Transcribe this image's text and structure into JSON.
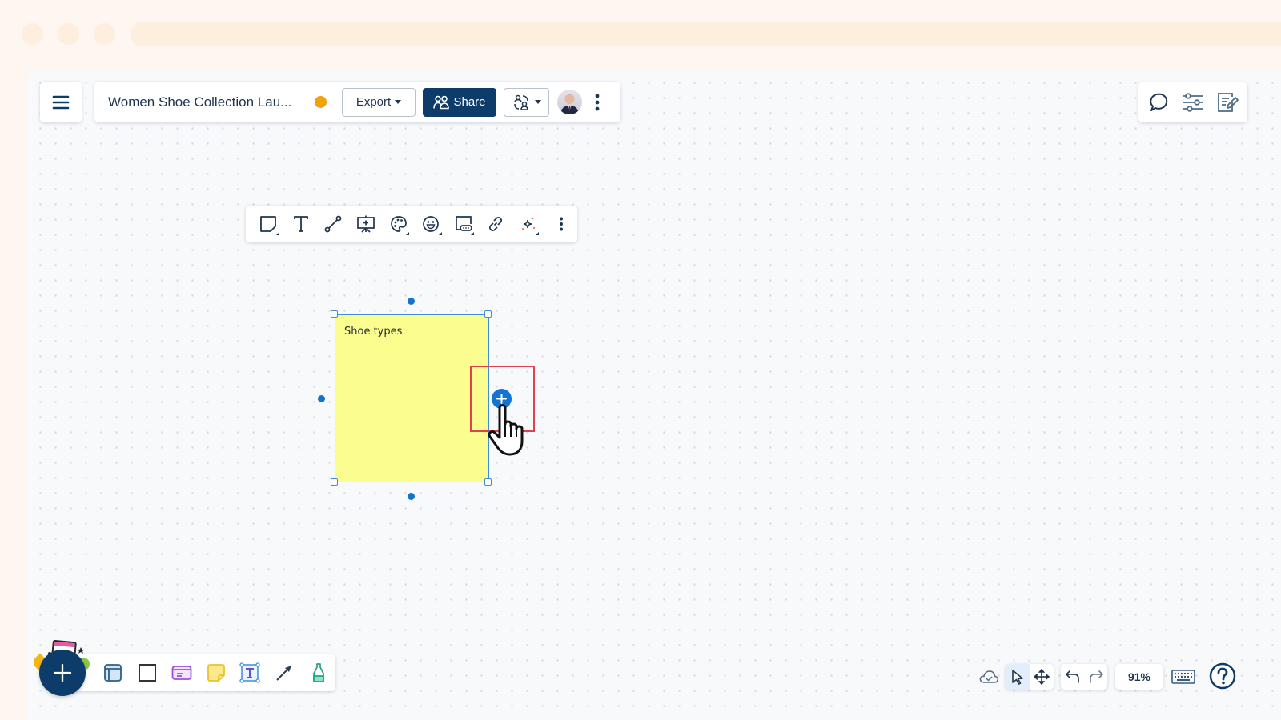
{
  "header": {
    "document_title": "Women Shoe Collection Lau...",
    "status_color": "#f0a20b",
    "export_label": "Export",
    "share_label": "Share"
  },
  "right_panel": {
    "icons": [
      "comment-icon",
      "settings-sliders-icon",
      "notes-edit-icon"
    ]
  },
  "context_toolbar": {
    "items": [
      "sticky-shape",
      "text",
      "connector-line",
      "presentation-add",
      "color-palette",
      "emoji",
      "button-widget",
      "link",
      "ai-sparkle",
      "more-options"
    ]
  },
  "canvas": {
    "sticky_note": {
      "text": "Shoe types",
      "fill_color": "#fbfe8e"
    }
  },
  "bottom_toolbar": {
    "items": [
      "frame",
      "rectangle",
      "card",
      "sticky-note",
      "text-box",
      "arrow",
      "marker"
    ]
  },
  "bottom_right": {
    "zoom_level": "91%"
  },
  "colors": {
    "brand": "#0d3c6b",
    "selection": "#3d8ee0",
    "accent_blue": "#1173d4",
    "highlight": "#e1404e"
  }
}
